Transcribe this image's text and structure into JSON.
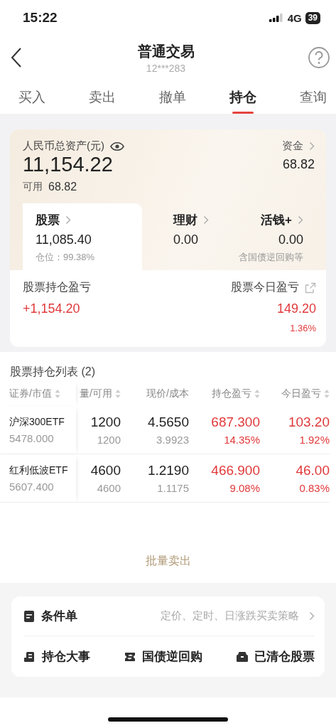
{
  "status_bar": {
    "time": "15:22",
    "network": "4G",
    "battery": "39"
  },
  "header": {
    "title": "普通交易",
    "account": "12***283"
  },
  "tabs": [
    {
      "label": "买入",
      "selected": false
    },
    {
      "label": "卖出",
      "selected": false
    },
    {
      "label": "撤单",
      "selected": false
    },
    {
      "label": "持仓",
      "selected": true
    },
    {
      "label": "查询",
      "selected": false
    }
  ],
  "assets": {
    "total_label": "人民币总资产(元)",
    "total": "11,154.22",
    "available_label": "可用",
    "available": "68.82",
    "funds_label": "资金",
    "funds": "68.82",
    "categories": [
      {
        "label": "股票",
        "value": "11,085.40",
        "note": "仓位：99.38%",
        "selected": true
      },
      {
        "label": "理财",
        "value": "0.00",
        "selected": false
      },
      {
        "label": "活钱+",
        "value": "0.00",
        "note": "含国债逆回购等",
        "selected": false
      }
    ],
    "holding_pnl_label": "股票持仓盈亏",
    "holding_pnl": "+1,154.20",
    "today_pnl_label": "股票今日盈亏",
    "today_pnl": "149.20",
    "today_pnl_pct": "1.36%"
  },
  "holdings": {
    "title": "股票持仓列表 (2)",
    "columns": [
      {
        "label": "证券/市值",
        "sortable": true
      },
      {
        "label": "量/可用",
        "sortable": true
      },
      {
        "label": "现价/成本",
        "sortable": false
      },
      {
        "label": "持仓盈亏",
        "sortable": true
      },
      {
        "label": "今日盈亏",
        "sortable": true
      }
    ],
    "rows": [
      {
        "name": "沪深300ETF",
        "market_value": "5478.000",
        "quantity": "1200",
        "available": "1200",
        "price": "4.5650",
        "cost": "3.9923",
        "pnl": "687.300",
        "pnl_pct": "14.35%",
        "today_pnl": "103.20",
        "today_pct": "1.92%"
      },
      {
        "name": "红利低波ETF",
        "market_value": "5607.400",
        "quantity": "4600",
        "available": "4600",
        "price": "1.2190",
        "cost": "1.1175",
        "pnl": "466.900",
        "pnl_pct": "9.08%",
        "today_pnl": "46.00",
        "today_pct": "0.83%"
      }
    ]
  },
  "batch_sell": "批量卖出",
  "conditional": {
    "label": "条件单",
    "hint": "定价、定时、日涨跌买卖策略"
  },
  "tools": [
    {
      "label": "持仓大事",
      "kind": "events"
    },
    {
      "label": "国债逆回购",
      "kind": "repo"
    },
    {
      "label": "已清仓股票",
      "kind": "cleared"
    }
  ]
}
